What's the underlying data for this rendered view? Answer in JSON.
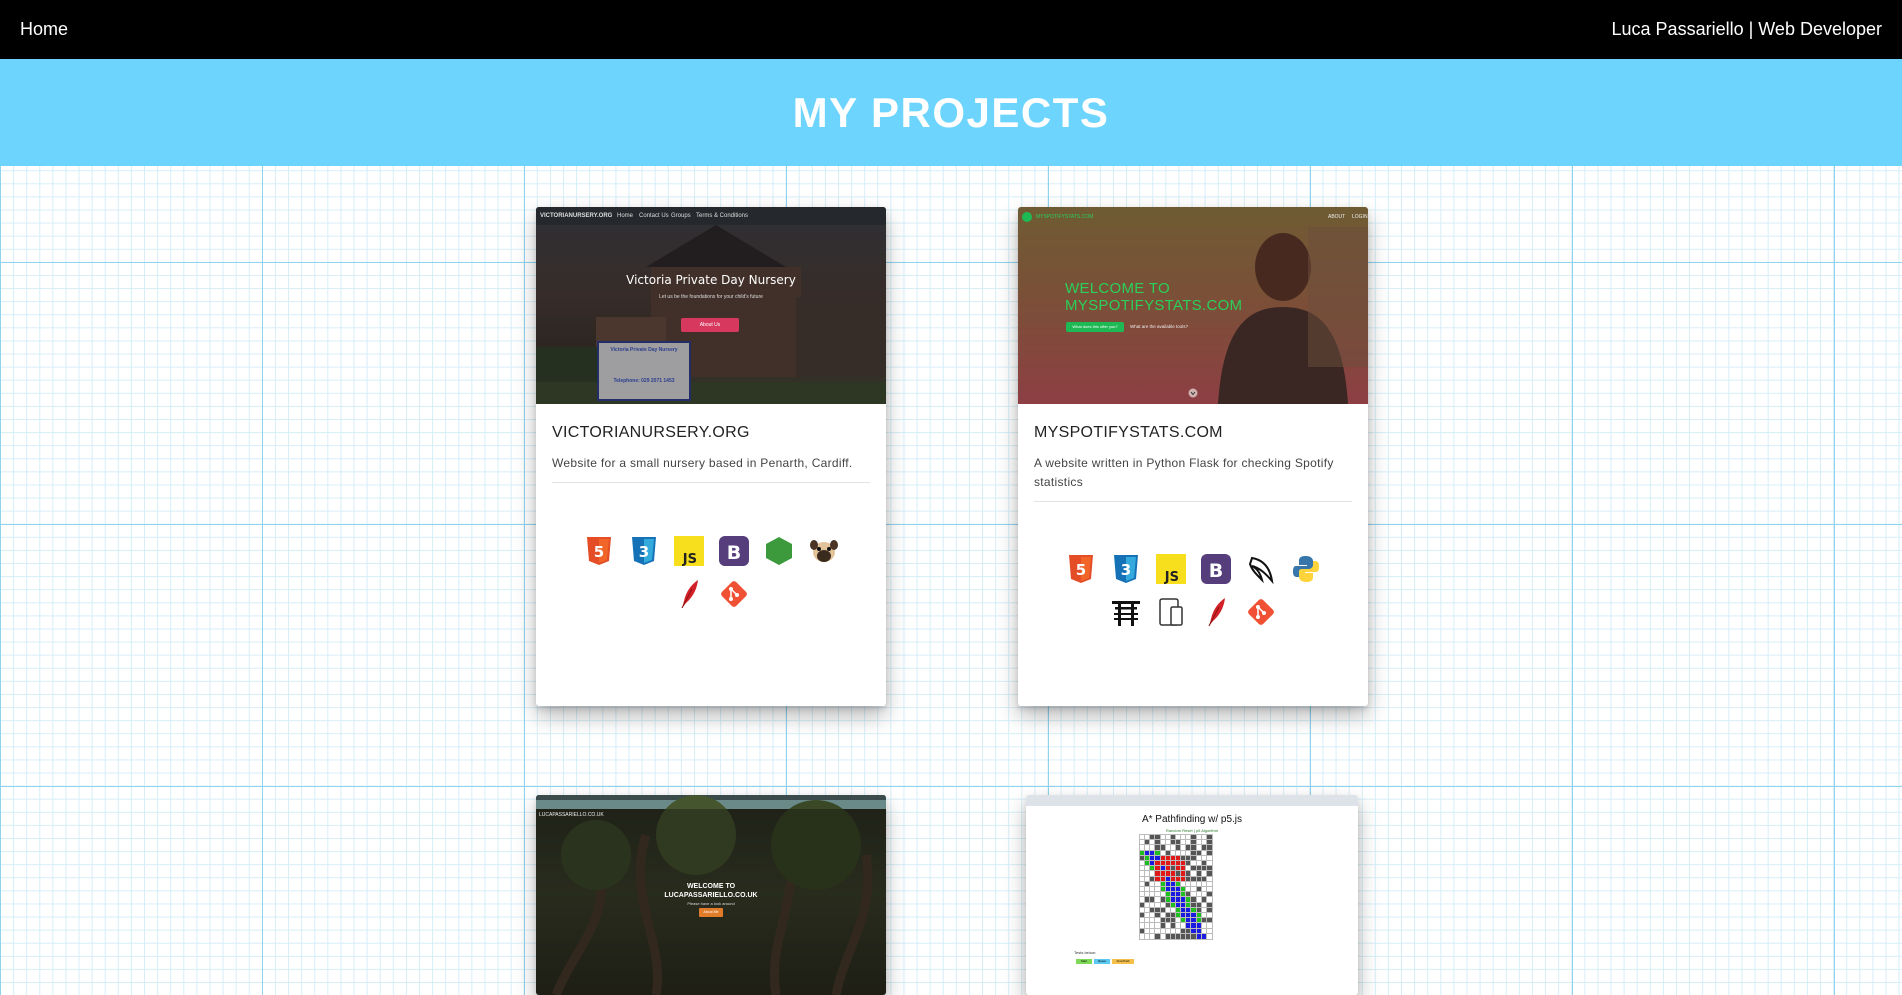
{
  "nav": {
    "home": "Home",
    "brand": "Luca Passariello | Web Developer"
  },
  "header": {
    "title": "MY PROJECTS"
  },
  "projects": [
    {
      "title": "VICTORIANURSERY.ORG",
      "description": "Website for a small nursery based in Penarth, Cardiff.",
      "thumb": {
        "site": "VICTORIANURSERY.ORG",
        "nav": [
          "Home",
          "Contact Us",
          "Groups",
          "Terms & Conditions"
        ],
        "heading": "Victoria Private Day Nursery",
        "tagline": "Let us be the foundations for your child's future",
        "button": "About Us",
        "sign_title": "Victoria Private Day Nursery",
        "sign_phone": "Telephone: 029 2071 1453"
      },
      "icons": [
        "html5-icon",
        "css3-icon",
        "javascript-icon",
        "bootstrap-icon",
        "nodejs-icon",
        "pug-icon",
        "feather-icon",
        "git-icon"
      ]
    },
    {
      "title": "MYSPOTIFYSTATS.COM",
      "description": "A website written in Python Flask for checking Spotify statistics",
      "thumb": {
        "site": "MYSPOTIFYSTATS.COM",
        "nav": [
          "ABOUT",
          "LOGIN"
        ],
        "heading_line1": "WELCOME TO",
        "heading_line2": "MYSPOTIFYSTATS.COM",
        "button": "What does this offer you?",
        "link": "What are the available tools?"
      },
      "icons": [
        "html5-icon",
        "css3-icon",
        "javascript-icon",
        "bootstrap-icon",
        "flask-icon",
        "python-icon",
        "torii-icon",
        "responsive-icon",
        "feather-icon",
        "git-icon"
      ]
    },
    {
      "thumb": {
        "site": "LUCAPASSARIELLO.CO.UK",
        "heading_line1": "WELCOME TO",
        "heading_line2": "LUCAPASSARIELLO.CO.UK",
        "tagline": "Please have a look around",
        "button": "About Me"
      }
    },
    {
      "thumb": {
        "heading": "A* Pathfinding w/ p5.js",
        "caption": "Random Reset | p5 Algorithm",
        "tests_label": "Tests below:",
        "buttons": [
          "Start",
          "Reset",
          "Find Path"
        ]
      }
    }
  ],
  "colors": {
    "hero": "#6cd4fd",
    "navbar": "#000000",
    "grid_major": "#8fd3ec",
    "grid_minor": "#d5eef8"
  }
}
